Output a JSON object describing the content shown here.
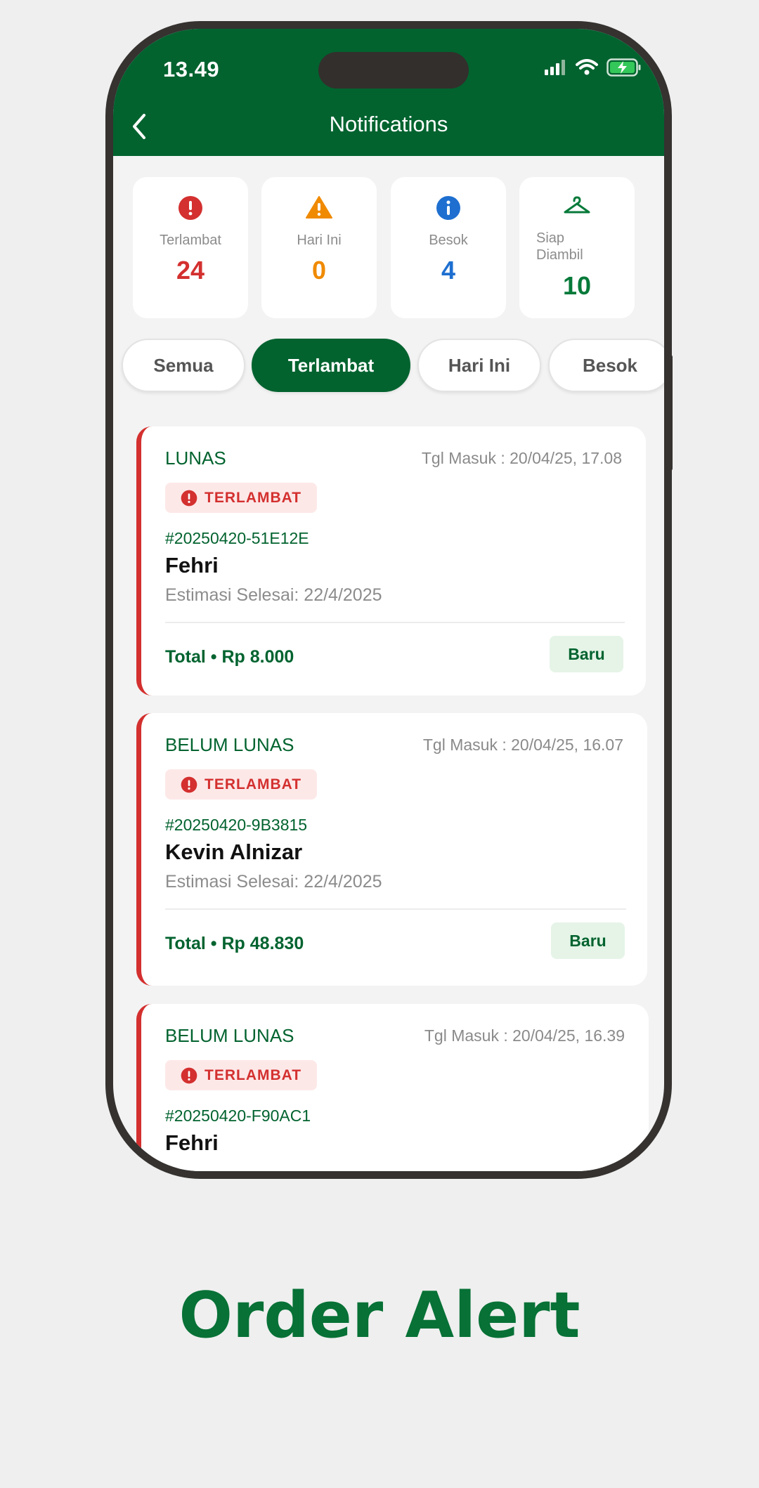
{
  "status_bar": {
    "time": "13.49"
  },
  "header": {
    "title": "Notifications"
  },
  "stats": [
    {
      "label": "Terlambat",
      "value": "24",
      "color": "#d3302f",
      "icon": "alert-circle-icon"
    },
    {
      "label": "Hari Ini",
      "value": "0",
      "color": "#f08a00",
      "icon": "warning-triangle-icon"
    },
    {
      "label": "Besok",
      "value": "4",
      "color": "#1e6fd0",
      "icon": "info-circle-icon"
    },
    {
      "label": "Siap Diambil",
      "value": "10",
      "color": "#077a3a",
      "icon": "hanger-icon"
    }
  ],
  "filters": [
    {
      "label": "Semua",
      "active": false
    },
    {
      "label": "Terlambat",
      "active": true
    },
    {
      "label": "Hari Ini",
      "active": false
    },
    {
      "label": "Besok",
      "active": false
    }
  ],
  "orders": [
    {
      "payment_status": "LUNAS",
      "date_in": "Tgl Masuk : 20/04/25, 17.08",
      "badge": "TERLAMBAT",
      "order_id": "#20250420-51E12E",
      "customer": "Fehri",
      "estimate": "Estimasi Selesai: 22/4/2025",
      "total": "Total • Rp 8.000",
      "state": "Baru"
    },
    {
      "payment_status": "BELUM LUNAS",
      "date_in": "Tgl Masuk : 20/04/25, 16.07",
      "badge": "TERLAMBAT",
      "order_id": "#20250420-9B3815",
      "customer": "Kevin Alnizar",
      "estimate": "Estimasi Selesai: 22/4/2025",
      "total": "Total • Rp 48.830",
      "state": "Baru"
    },
    {
      "payment_status": "BELUM LUNAS",
      "date_in": "Tgl Masuk : 20/04/25, 16.39",
      "badge": "TERLAMBAT",
      "order_id": "#20250420-F90AC1",
      "customer": "Fehri"
    }
  ],
  "caption": "Order Alert",
  "colors": {
    "brand_green": "#02632f",
    "late_red": "#d3302f",
    "background": "#efefef"
  }
}
